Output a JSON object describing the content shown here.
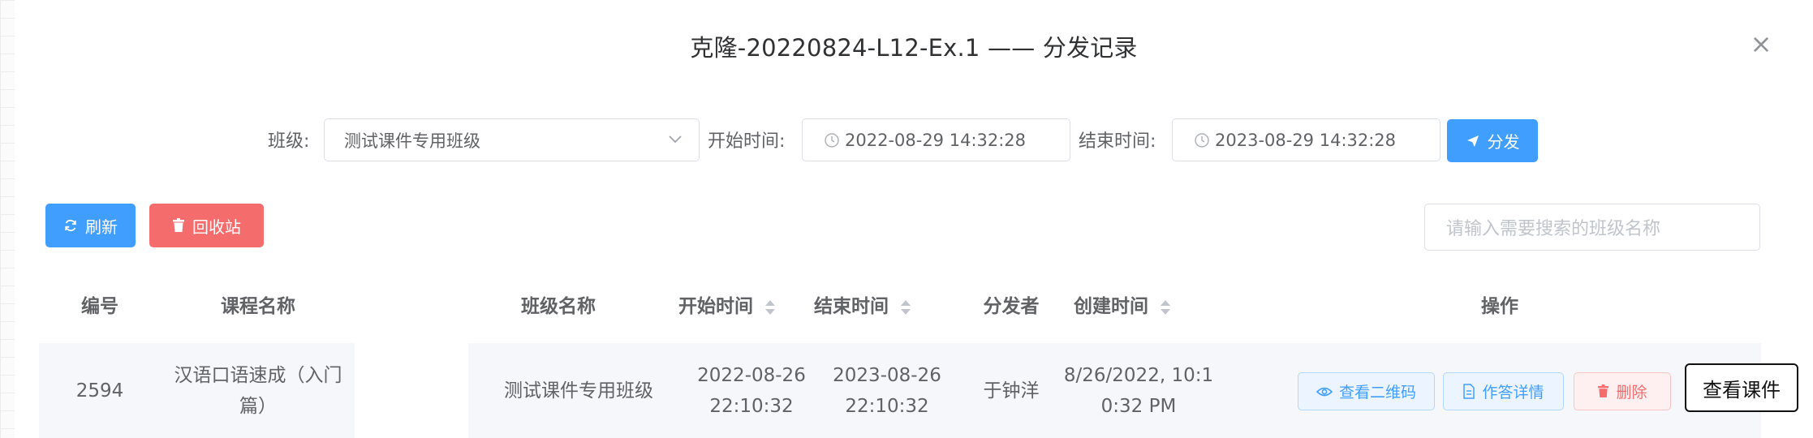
{
  "dialog": {
    "title": "克隆-20220824-L12-Ex.1 —— 分发记录",
    "close_icon": "close-icon"
  },
  "filter": {
    "class_label": "班级:",
    "class_value": "测试课件专用班级",
    "start_label": "开始时间:",
    "start_value": "2022-08-29 14:32:28",
    "end_label": "结束时间:",
    "end_value": "2023-08-29 14:32:28",
    "distribute_label": "分发",
    "distribute_icon": "send-icon"
  },
  "toolbar": {
    "refresh_label": "刷新",
    "refresh_icon": "refresh-icon",
    "recycle_label": "回收站",
    "recycle_icon": "trash-icon",
    "search_placeholder": "请输入需要搜索的班级名称"
  },
  "table": {
    "headers": {
      "id": "编号",
      "course": "课程名称",
      "class_name": "班级名称",
      "start": "开始时间",
      "end": "结束时间",
      "distributor": "分发者",
      "created": "创建时间",
      "actions": "操作"
    },
    "rows": [
      {
        "id": "2594",
        "course_line1": "汉语口语速成（入门",
        "course_line2": "篇）",
        "class_name": "测试课件专用班级",
        "start_line1": "2022-08-26",
        "start_line2": "22:10:32",
        "end_line1": "2023-08-26",
        "end_line2": "22:10:32",
        "distributor": "于钟洋",
        "created_line1": "8/26/2022, 10:1",
        "created_line2": "0:32 PM",
        "actions": {
          "qr_label": "查看二维码",
          "qr_icon": "eye-icon",
          "detail_label": "作答详情",
          "detail_icon": "document-icon",
          "delete_label": "删除",
          "delete_icon": "trash-icon"
        }
      }
    ]
  },
  "tooltip": {
    "label": "查看课件"
  },
  "colors": {
    "primary": "#409eff",
    "danger": "#f56c6c",
    "row_bg": "#f5f7fa"
  }
}
